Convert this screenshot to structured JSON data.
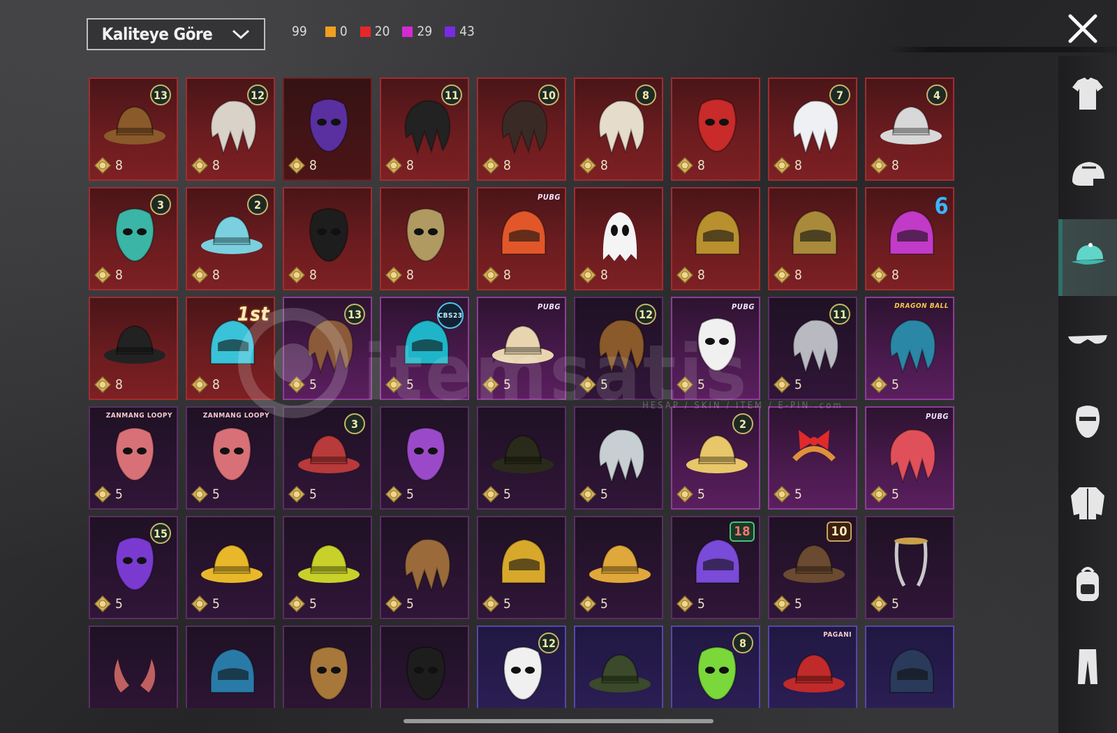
{
  "sort": {
    "label": "Kaliteye Göre"
  },
  "counts": {
    "total": "99",
    "groups": [
      {
        "color": "#f0a01e",
        "value": "0"
      },
      {
        "color": "#e8262a",
        "value": "20"
      },
      {
        "color": "#d42ad4",
        "value": "29"
      },
      {
        "color": "#7a2ae6",
        "value": "43"
      }
    ]
  },
  "watermark": {
    "brand": "itemsatis",
    "sub": "HESAP / SKIN / ITEM / E-PIN .com"
  },
  "categories": [
    {
      "name": "outfit",
      "icon": "shirt-icon"
    },
    {
      "name": "helmet",
      "icon": "helmet-icon"
    },
    {
      "name": "hat",
      "icon": "cap-icon",
      "active": true
    },
    {
      "name": "eyewear",
      "icon": "glasses-icon"
    },
    {
      "name": "mask",
      "icon": "mask-icon"
    },
    {
      "name": "jacket",
      "icon": "jacket-icon"
    },
    {
      "name": "backpack",
      "icon": "backpack-icon"
    },
    {
      "name": "pants",
      "icon": "pants-icon"
    }
  ],
  "items": [
    {
      "theme": "red",
      "tag": "13",
      "price": "8",
      "art": "hat",
      "c": "#8a5a2a"
    },
    {
      "theme": "red",
      "tag": "12",
      "price": "8",
      "art": "hair",
      "c": "#d9d2c8"
    },
    {
      "theme": "darkred",
      "tag": "",
      "price": "8",
      "art": "mask",
      "c": "#5a2fa0"
    },
    {
      "theme": "red",
      "tag": "11",
      "price": "8",
      "art": "hair",
      "c": "#222"
    },
    {
      "theme": "red",
      "tag": "10",
      "price": "8",
      "art": "hair",
      "c": "#3a2a25"
    },
    {
      "theme": "red",
      "tag": "8",
      "price": "8",
      "art": "hair",
      "c": "#e5dccb"
    },
    {
      "theme": "red",
      "tag": "",
      "price": "8",
      "art": "mask",
      "c": "#c92a2a"
    },
    {
      "theme": "red",
      "tag": "7",
      "price": "8",
      "art": "hair",
      "c": "#eef0f4"
    },
    {
      "theme": "red",
      "tag": "4",
      "price": "8",
      "art": "hat",
      "c": "#d8d8d8"
    },
    {
      "theme": "red",
      "tag": "3",
      "price": "8",
      "art": "mask",
      "c": "#3bb5a5"
    },
    {
      "theme": "red",
      "tag": "2",
      "price": "8",
      "art": "hat",
      "c": "#7ad0de"
    },
    {
      "theme": "red",
      "tag": "",
      "price": "8",
      "art": "mask",
      "c": "#1d1d1d"
    },
    {
      "theme": "red",
      "tag": "",
      "price": "8",
      "art": "mask",
      "c": "#b09a62"
    },
    {
      "theme": "red",
      "tag": "PUBG",
      "tagtype": "logo",
      "price": "8",
      "art": "helmet",
      "c": "#e2572a"
    },
    {
      "theme": "red",
      "tag": "",
      "price": "8",
      "art": "ghost",
      "c": "#f4f4f4"
    },
    {
      "theme": "red",
      "tag": "",
      "price": "8",
      "art": "helmet",
      "c": "#b8902e"
    },
    {
      "theme": "red",
      "tag": "",
      "price": "8",
      "art": "helmet",
      "c": "#a88a3a"
    },
    {
      "theme": "red",
      "tag": "6",
      "tagtype": "six",
      "price": "8",
      "art": "helmet",
      "c": "#c23ac8"
    },
    {
      "theme": "red",
      "tag": "",
      "price": "8",
      "art": "hat",
      "c": "#222"
    },
    {
      "theme": "red",
      "tag": "1st",
      "tagtype": "first",
      "price": "8",
      "art": "helmet",
      "c": "#3ac2d8"
    },
    {
      "theme": "purple",
      "tag": "13",
      "price": "5",
      "art": "hair",
      "c": "#8a5a3a"
    },
    {
      "theme": "purple",
      "tag": "CBS23",
      "tagtype": "cbs",
      "price": "5",
      "art": "helmet",
      "c": "#1fb5c9"
    },
    {
      "theme": "purple",
      "tag": "PUBG",
      "tagtype": "logo",
      "price": "5",
      "art": "hat",
      "c": "#e8d5b0"
    },
    {
      "theme": "darkpurple",
      "tag": "12",
      "price": "5",
      "art": "hair",
      "c": "#8a5a2a"
    },
    {
      "theme": "purple",
      "tag": "PUBG",
      "tagtype": "logo",
      "price": "5",
      "art": "mask",
      "c": "#f0f0f0"
    },
    {
      "theme": "darkpurple",
      "tag": "11",
      "price": "5",
      "art": "hair",
      "c": "#b9b9c2"
    },
    {
      "theme": "purple",
      "tag": "DRAGON BALL",
      "tagtype": "dragon",
      "price": "5",
      "art": "hair",
      "c": "#2a87a6"
    },
    {
      "theme": "darkpurple",
      "tag": "ZANMANG LOOPY",
      "tagtype": "brand",
      "price": "5",
      "art": "mask",
      "c": "#d87078"
    },
    {
      "theme": "darkpurple",
      "tag": "ZANMANG LOOPY",
      "tagtype": "brand",
      "price": "5",
      "art": "mask",
      "c": "#d87078"
    },
    {
      "theme": "darkpurple",
      "tag": "3",
      "price": "5",
      "art": "hat",
      "c": "#b83a3a"
    },
    {
      "theme": "darkpurple",
      "tag": "",
      "price": "5",
      "art": "mask",
      "c": "#9a4ac8"
    },
    {
      "theme": "darkpurple",
      "tag": "",
      "price": "5",
      "art": "hat",
      "c": "#2a2a1a"
    },
    {
      "theme": "darkpurple",
      "tag": "",
      "price": "5",
      "art": "hair",
      "c": "#c7cfd2"
    },
    {
      "theme": "purple",
      "tag": "2",
      "price": "5",
      "art": "hat",
      "c": "#e8c66a"
    },
    {
      "theme": "purple",
      "tag": "",
      "price": "5",
      "art": "bow",
      "c": "#e02a2a"
    },
    {
      "theme": "purple",
      "tag": "PUBG",
      "tagtype": "logo",
      "price": "5",
      "art": "hair",
      "c": "#e0505a"
    },
    {
      "theme": "darkpurple",
      "tag": "15",
      "price": "5",
      "art": "mask",
      "c": "#7a3ad0"
    },
    {
      "theme": "darkpurple",
      "tag": "",
      "price": "5",
      "art": "hat",
      "c": "#e8b82a"
    },
    {
      "theme": "darkpurple",
      "tag": "",
      "price": "5",
      "art": "hat",
      "c": "#c8d02a"
    },
    {
      "theme": "darkpurple",
      "tag": "",
      "price": "5",
      "art": "hair",
      "c": "#9a6a3a"
    },
    {
      "theme": "darkpurple",
      "tag": "",
      "price": "5",
      "art": "helmet",
      "c": "#d8a82a"
    },
    {
      "theme": "darkpurple",
      "tag": "",
      "price": "5",
      "art": "hat",
      "c": "#e0a83a"
    },
    {
      "theme": "darkpurple",
      "tag": "18",
      "tagtype": "boxgreen",
      "price": "5",
      "art": "helmet",
      "c": "#7a4ad8"
    },
    {
      "theme": "darkpurple",
      "tag": "10",
      "tagtype": "box",
      "price": "5",
      "art": "hat",
      "c": "#6a4a30"
    },
    {
      "theme": "darkpurple",
      "tag": "",
      "price": "5",
      "art": "band",
      "c": "#c8c8c8"
    },
    {
      "theme": "darkpurple",
      "tag": "",
      "price": "",
      "art": "horns",
      "c": "#c06060"
    },
    {
      "theme": "darkpurple",
      "tag": "",
      "price": "",
      "art": "helmet",
      "c": "#2a7aa8"
    },
    {
      "theme": "darkpurple",
      "tag": "",
      "price": "",
      "art": "mask",
      "c": "#a8783a"
    },
    {
      "theme": "darkpurple",
      "tag": "",
      "price": "",
      "art": "mask",
      "c": "#1d1d1d"
    },
    {
      "theme": "violet",
      "tag": "12",
      "price": "",
      "art": "mask",
      "c": "#f0f0f0"
    },
    {
      "theme": "violet",
      "tag": "",
      "price": "",
      "art": "hat",
      "c": "#3a4a2a"
    },
    {
      "theme": "violet",
      "tag": "8",
      "price": "",
      "art": "mask",
      "c": "#7ad83a"
    },
    {
      "theme": "violet",
      "tag": "PAGANI",
      "tagtype": "brand",
      "price": "",
      "art": "hat",
      "c": "#c02a2a"
    },
    {
      "theme": "violet",
      "tag": "",
      "price": "",
      "art": "helmet",
      "c": "#2a3a5a"
    }
  ]
}
